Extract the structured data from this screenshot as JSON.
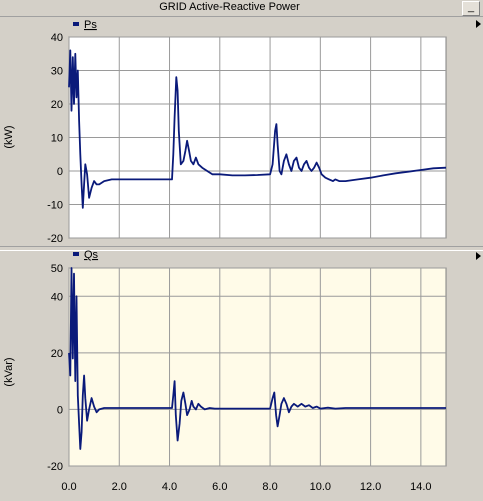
{
  "window": {
    "title": "GRID Active-Reactive Power",
    "minimize_label": "_"
  },
  "colors": {
    "trace": "#0a1a7a",
    "plot1_bg": "#ffffff",
    "plot2_bg": "#fffbe8",
    "grid": "#9a9a9a",
    "frame": "#d4d0c8"
  },
  "chart_data": [
    {
      "type": "line",
      "title": "",
      "xlabel": "",
      "ylabel": "(kW)",
      "xlim": [
        0,
        15
      ],
      "ylim": [
        -20,
        40
      ],
      "yticks": [
        "40",
        "30",
        "20",
        "10",
        "0",
        "-10",
        "-20"
      ],
      "grid": true,
      "legend_position": "top-left",
      "series": [
        {
          "name": "Ps",
          "points": [
            [
              0,
              25
            ],
            [
              0.05,
              36
            ],
            [
              0.1,
              18
            ],
            [
              0.15,
              34
            ],
            [
              0.2,
              20
            ],
            [
              0.25,
              35
            ],
            [
              0.3,
              22
            ],
            [
              0.35,
              30
            ],
            [
              0.4,
              15
            ],
            [
              0.45,
              5
            ],
            [
              0.5,
              -4
            ],
            [
              0.55,
              -11
            ],
            [
              0.6,
              -4
            ],
            [
              0.65,
              2
            ],
            [
              0.72,
              -1
            ],
            [
              0.8,
              -8
            ],
            [
              0.9,
              -5
            ],
            [
              1.0,
              -3
            ],
            [
              1.1,
              -4
            ],
            [
              1.2,
              -4
            ],
            [
              1.4,
              -3
            ],
            [
              1.7,
              -2.5
            ],
            [
              2.5,
              -2.5
            ],
            [
              3.5,
              -2.5
            ],
            [
              4.1,
              -2.5
            ],
            [
              4.15,
              5
            ],
            [
              4.2,
              16
            ],
            [
              4.27,
              28
            ],
            [
              4.32,
              24
            ],
            [
              4.37,
              12
            ],
            [
              4.45,
              2
            ],
            [
              4.55,
              3
            ],
            [
              4.63,
              6
            ],
            [
              4.7,
              9
            ],
            [
              4.78,
              6
            ],
            [
              4.85,
              3
            ],
            [
              4.95,
              2
            ],
            [
              5.05,
              4
            ],
            [
              5.15,
              2
            ],
            [
              5.3,
              1
            ],
            [
              5.5,
              0
            ],
            [
              5.7,
              -1
            ],
            [
              6.0,
              -1
            ],
            [
              6.5,
              -1.3
            ],
            [
              7.0,
              -1.3
            ],
            [
              7.5,
              -1.2
            ],
            [
              8.0,
              -1
            ],
            [
              8.1,
              2
            ],
            [
              8.2,
              12
            ],
            [
              8.25,
              14
            ],
            [
              8.3,
              8
            ],
            [
              8.38,
              0
            ],
            [
              8.45,
              -1
            ],
            [
              8.55,
              3
            ],
            [
              8.65,
              5
            ],
            [
              8.75,
              2
            ],
            [
              8.85,
              0
            ],
            [
              8.95,
              3
            ],
            [
              9.05,
              4
            ],
            [
              9.15,
              1
            ],
            [
              9.25,
              0
            ],
            [
              9.35,
              2
            ],
            [
              9.45,
              3
            ],
            [
              9.55,
              1
            ],
            [
              9.65,
              0
            ],
            [
              9.75,
              1
            ],
            [
              9.85,
              2.5
            ],
            [
              9.95,
              1
            ],
            [
              10.05,
              -1
            ],
            [
              10.2,
              -2
            ],
            [
              10.35,
              -2.5
            ],
            [
              10.5,
              -3
            ],
            [
              10.6,
              -2.5
            ],
            [
              10.75,
              -3
            ],
            [
              11.0,
              -3
            ],
            [
              11.5,
              -2.5
            ],
            [
              12.0,
              -2
            ],
            [
              12.5,
              -1.3
            ],
            [
              13.0,
              -0.7
            ],
            [
              13.5,
              -0.2
            ],
            [
              14.0,
              0.3
            ],
            [
              14.5,
              0.8
            ],
            [
              15.0,
              1
            ]
          ]
        }
      ]
    },
    {
      "type": "line",
      "title": "",
      "xlabel": "",
      "ylabel": "(kVar)",
      "xlim": [
        0,
        15
      ],
      "ylim": [
        -20,
        50
      ],
      "yticks": [
        "50",
        "40",
        "20",
        "0",
        "-20"
      ],
      "xticks": [
        "0.0",
        "2.0",
        "4.0",
        "6.0",
        "8.0",
        "10.0",
        "12.0",
        "14.0"
      ],
      "grid": true,
      "legend_position": "top-left",
      "series": [
        {
          "name": "Qs",
          "points": [
            [
              0,
              20
            ],
            [
              0.05,
              12
            ],
            [
              0.1,
              50
            ],
            [
              0.15,
              18
            ],
            [
              0.2,
              48
            ],
            [
              0.25,
              10
            ],
            [
              0.3,
              40
            ],
            [
              0.35,
              5
            ],
            [
              0.4,
              -5
            ],
            [
              0.45,
              -14
            ],
            [
              0.5,
              -8
            ],
            [
              0.55,
              5
            ],
            [
              0.6,
              12
            ],
            [
              0.65,
              4
            ],
            [
              0.72,
              -4
            ],
            [
              0.8,
              0
            ],
            [
              0.9,
              4
            ],
            [
              1.0,
              1
            ],
            [
              1.1,
              -1
            ],
            [
              1.2,
              0
            ],
            [
              1.4,
              0.5
            ],
            [
              1.7,
              0.5
            ],
            [
              2.5,
              0.5
            ],
            [
              3.5,
              0.5
            ],
            [
              4.1,
              0.5
            ],
            [
              4.15,
              5
            ],
            [
              4.2,
              10
            ],
            [
              4.25,
              -2
            ],
            [
              4.32,
              -11
            ],
            [
              4.4,
              -5
            ],
            [
              4.47,
              3
            ],
            [
              4.55,
              6
            ],
            [
              4.63,
              2
            ],
            [
              4.7,
              -2
            ],
            [
              4.8,
              0
            ],
            [
              4.88,
              3
            ],
            [
              4.95,
              1
            ],
            [
              5.05,
              0
            ],
            [
              5.15,
              2
            ],
            [
              5.25,
              1
            ],
            [
              5.4,
              0
            ],
            [
              5.6,
              0.5
            ],
            [
              5.8,
              0.3
            ],
            [
              6.5,
              0.3
            ],
            [
              7.5,
              0.3
            ],
            [
              8.0,
              0.3
            ],
            [
              8.1,
              4
            ],
            [
              8.17,
              6
            ],
            [
              8.24,
              -2
            ],
            [
              8.3,
              -6
            ],
            [
              8.38,
              -2
            ],
            [
              8.45,
              2
            ],
            [
              8.55,
              4
            ],
            [
              8.65,
              2
            ],
            [
              8.75,
              -1
            ],
            [
              8.85,
              1
            ],
            [
              8.95,
              2
            ],
            [
              9.1,
              1
            ],
            [
              9.25,
              2
            ],
            [
              9.4,
              1
            ],
            [
              9.55,
              1.5
            ],
            [
              9.7,
              0.5
            ],
            [
              9.85,
              1
            ],
            [
              10.0,
              0.3
            ],
            [
              10.3,
              0.6
            ],
            [
              10.6,
              0.3
            ],
            [
              11.0,
              0.5
            ],
            [
              12.0,
              0.5
            ],
            [
              13.0,
              0.5
            ],
            [
              14.0,
              0.5
            ],
            [
              15.0,
              0.5
            ]
          ]
        }
      ]
    }
  ]
}
